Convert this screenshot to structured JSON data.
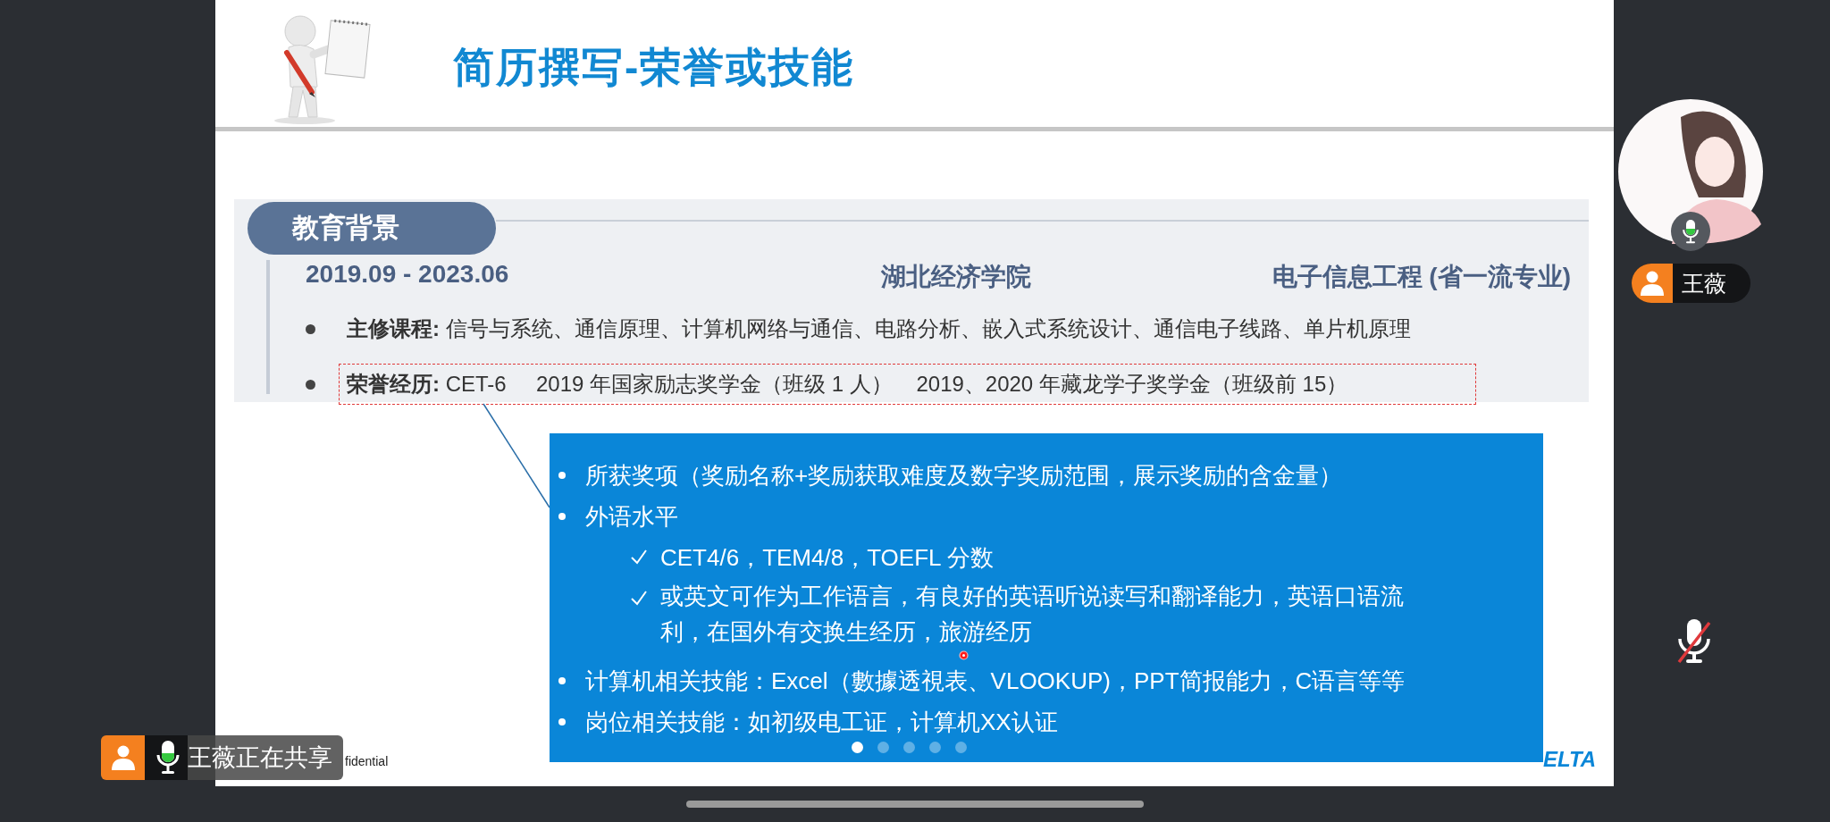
{
  "slide": {
    "title": "简历撰写-荣誉或技能",
    "section_tag": "教育背景",
    "education": {
      "period": "2019.09 - 2023.06",
      "school": "湖北经济学院",
      "major": "电子信息工程 (省一流专业)"
    },
    "bullets": [
      {
        "text": "**主修课程:** 信号与系统、通信原理、计算机网络与通信、电路分析、嵌入式系统设计、通信电子线路、单片机原理",
        "highlighted": false
      },
      {
        "text": "**荣誉经历:** CET-6     2019 年国家励志奖学金（班级 1 人）    2019、2020 年藏龙学子奖学金（班级前 15）",
        "highlighted": true
      }
    ],
    "callout": {
      "items": [
        {
          "kind": "bullet",
          "text": "所获奖项（奖励名称+奖励获取难度及数字奖励范围，展示奖励的含金量）"
        },
        {
          "kind": "bullet",
          "text": "外语水平"
        },
        {
          "kind": "check",
          "text": "CET4/6，TEM4/8，TOEFL 分数"
        },
        {
          "kind": "check",
          "text": "或英文可作为工作语言，有良好的英语听说读写和翻译能力，英语口语流利，在国外有交换生经历，旅游经历"
        },
        {
          "kind": "bullet",
          "text": "计算机相关技能：Excel（數據透視表、VLOOKUP)，PPT简报能力，C语言等等"
        },
        {
          "kind": "bullet",
          "text": "岗位相关技能：如初级电工证，计算机XX认证"
        }
      ]
    },
    "pagination": [
      {
        "selected": true
      },
      {
        "selected": false
      },
      {
        "selected": false
      },
      {
        "selected": false
      },
      {
        "selected": false
      }
    ],
    "footer": "fidential",
    "logo": "ELTA"
  },
  "participant": {
    "name": "王薇",
    "speaking": true
  },
  "share_banner": {
    "text": "王薇正在共享"
  },
  "mic_button": {
    "muted": true
  }
}
